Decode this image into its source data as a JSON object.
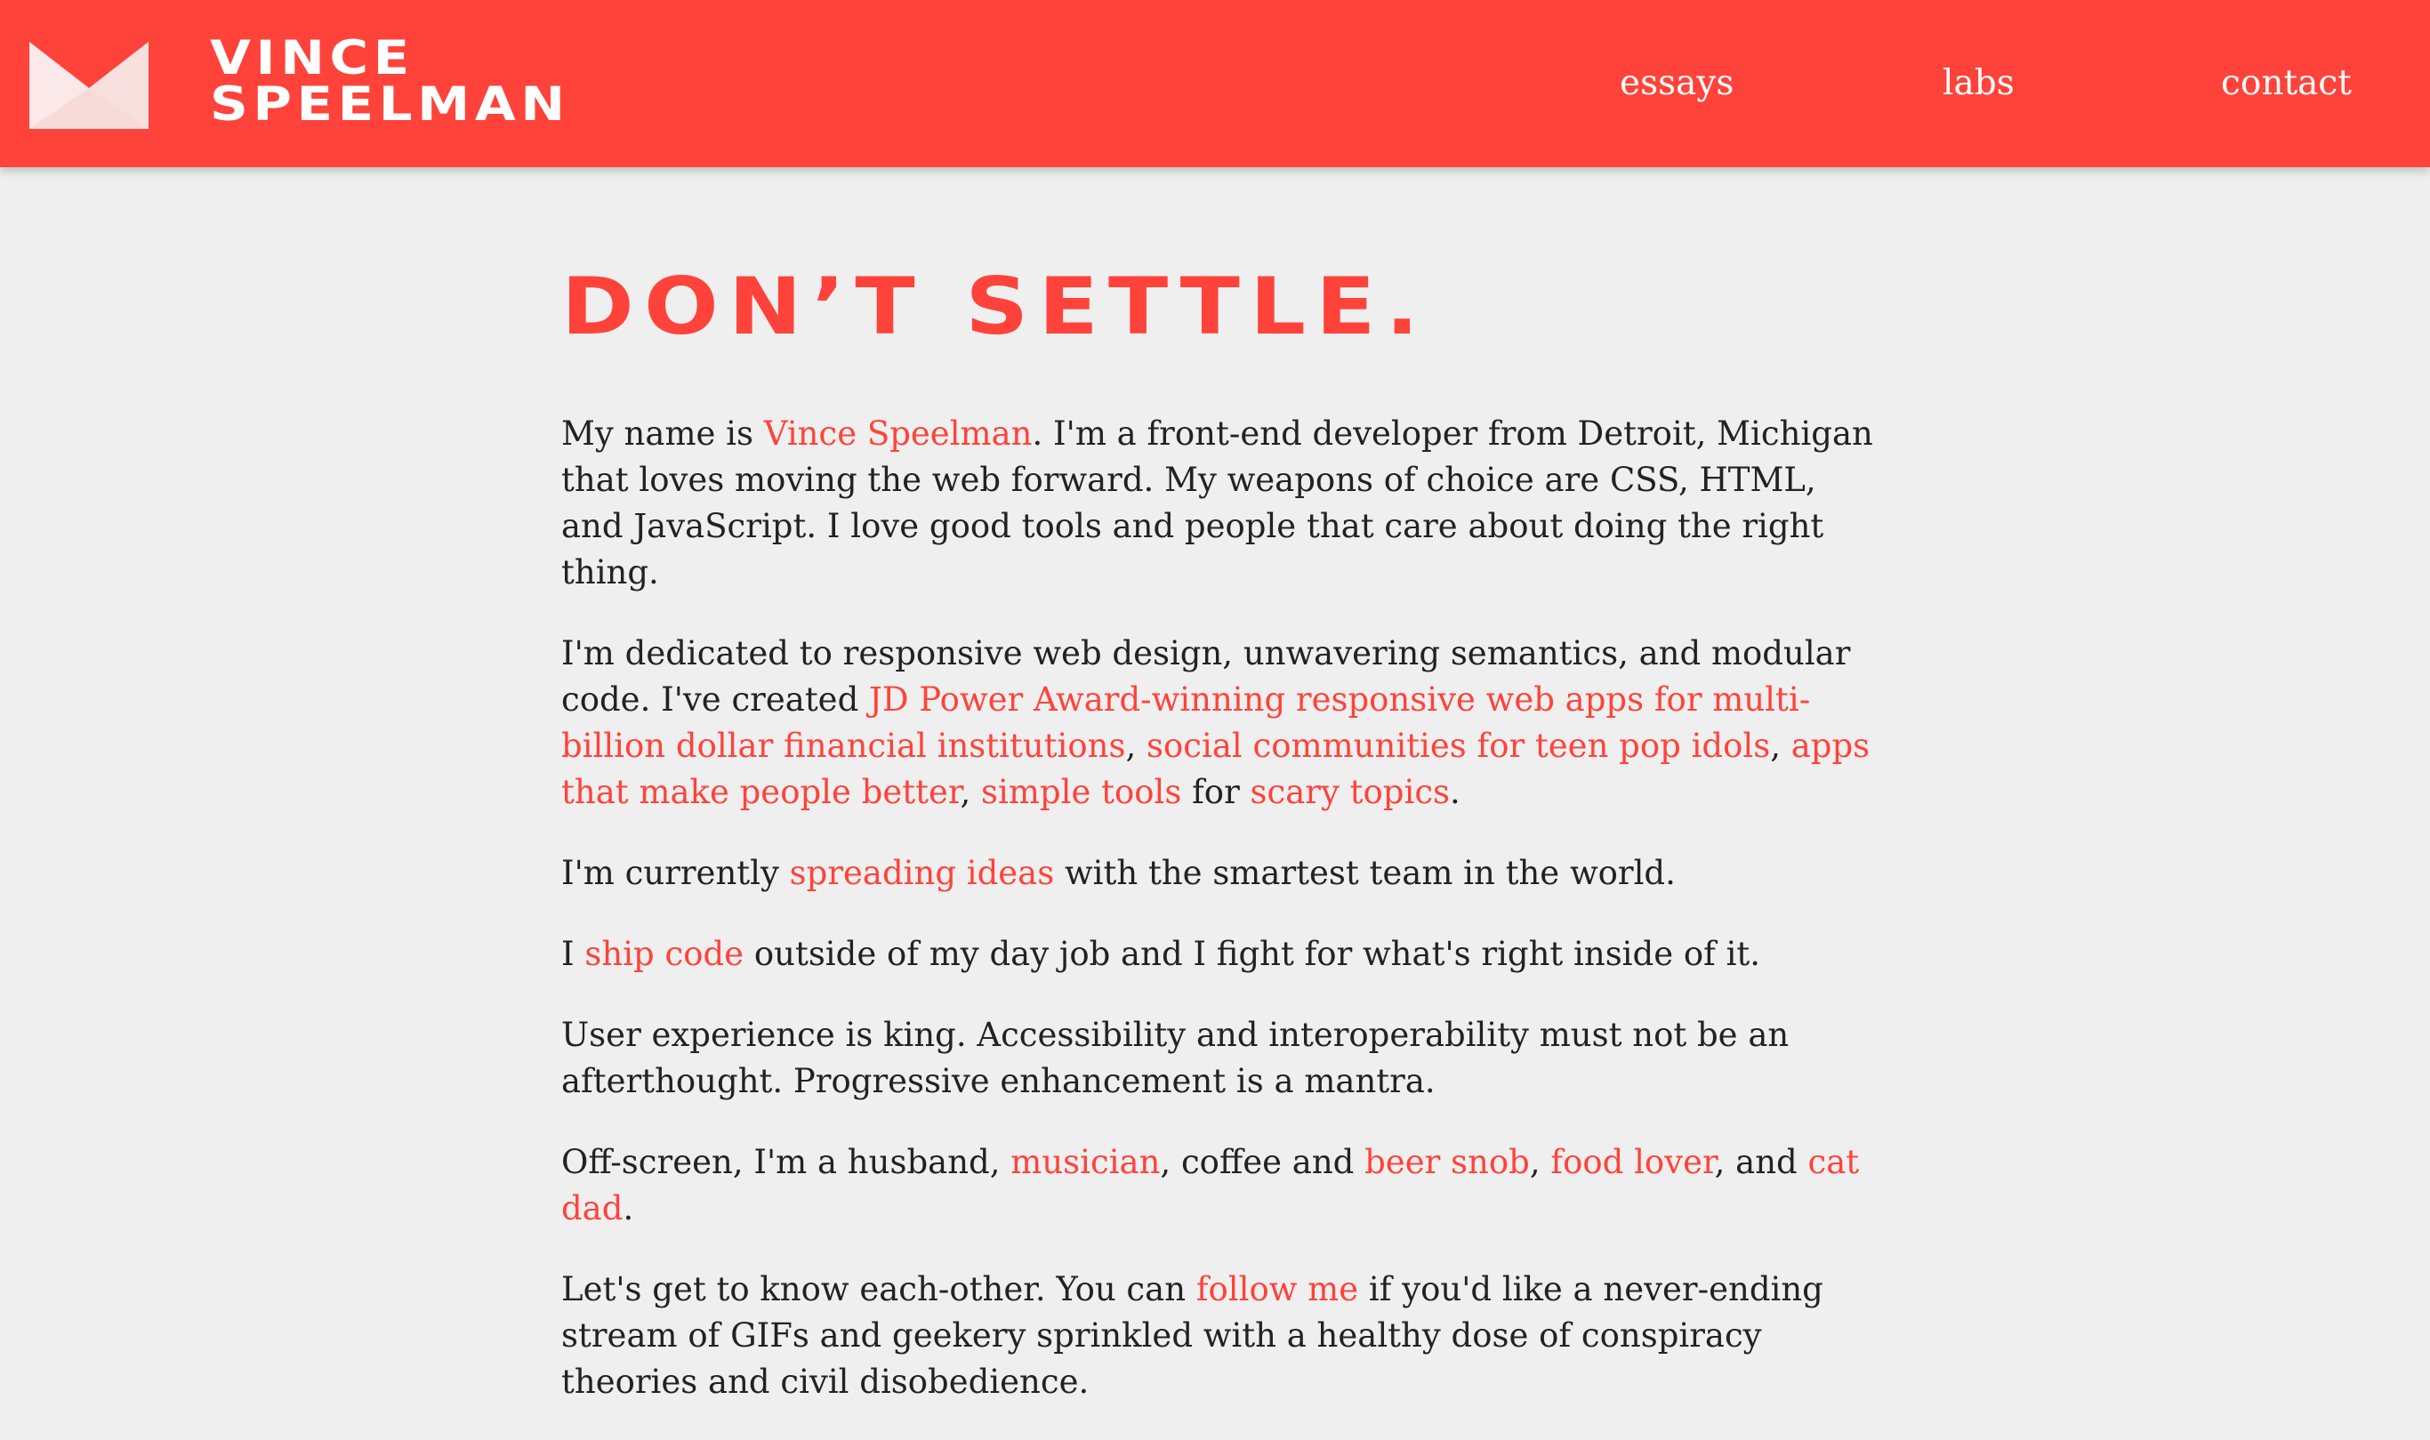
{
  "header": {
    "logo_line1": "Vince",
    "logo_line2": "Speelman",
    "nav": {
      "essays": "essays",
      "labs": "labs",
      "contact": "contact"
    }
  },
  "main": {
    "headline": "Don’t settle.",
    "p1": {
      "t1": "My name is ",
      "link_name": "Vince Speelman",
      "t2": ". I'm a front-end developer from Detroit, Michigan that loves moving the web forward. My weapons of choice are CSS, HTML, and JavaScript. I love good tools and people that care about doing the right thing."
    },
    "p2": {
      "t1": "I'm dedicated to responsive web design, unwavering semantics, and modular code. I've created ",
      "link_jd": "JD Power Award-winning responsive web apps for multi-billion dollar financial institutions",
      "sep1": ", ",
      "link_social": "social communities for teen pop idols",
      "sep2": ", ",
      "link_apps": "apps that make people better",
      "sep3": ", ",
      "link_tools": "simple tools",
      "t_for": " for ",
      "link_scary": "scary topics",
      "t_end": "."
    },
    "p3": {
      "t1": "I'm currently ",
      "link_ideas": "spreading ideas",
      "t2": " with the smartest team in the world."
    },
    "p4": {
      "t1": "I ",
      "link_ship": "ship code",
      "t2": " outside of my day job and I fight for what's right inside of it."
    },
    "p5": {
      "t1": "User experience is king. Accessibility and interoperability must not be an afterthought. Progressive enhancement is a mantra."
    },
    "p6": {
      "t1": "Off-screen, I'm a husband, ",
      "link_musician": "musician",
      "t2": ", coffee and ",
      "link_beer": "beer snob",
      "sep1": ", ",
      "link_food": "food lover",
      "t3": ", and ",
      "link_cat": "cat dad",
      "t_end": "."
    },
    "p7": {
      "t1": "Let's get to know each-other. You can ",
      "link_follow": "follow me",
      "t2": " if you'd like a never-ending stream of GIFs and geekery sprinkled with a healthy dose of conspiracy theories and civil disobedience."
    }
  },
  "colors": {
    "brand_red": "#ff433a",
    "background": "#efefef",
    "text": "#222222"
  }
}
